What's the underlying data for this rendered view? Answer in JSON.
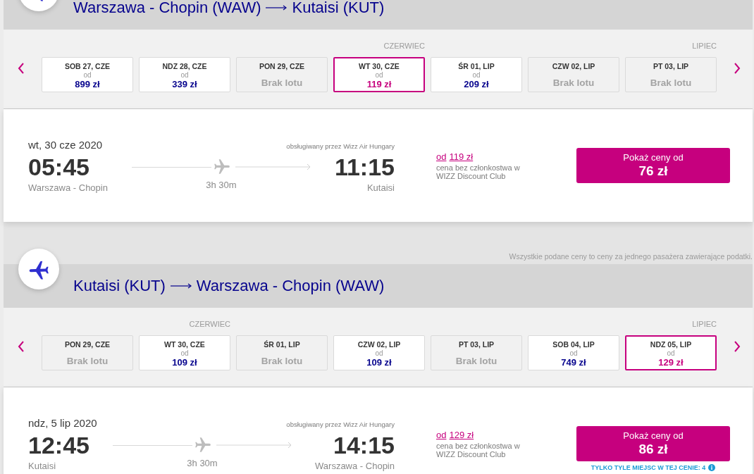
{
  "sections": [
    {
      "route_from": "Warszawa - Chopin (WAW)",
      "route_to": "Kutaisi (KUT)",
      "days": [
        {
          "kind": "fare",
          "label": "SOB 27, CZE",
          "from": "od",
          "price": "899 zł",
          "selected": false
        },
        {
          "kind": "fare",
          "label": "NDZ 28, CZE",
          "from": "od",
          "price": "339 zł",
          "selected": false
        },
        {
          "kind": "unavailable",
          "label": "PON 29, CZE",
          "note": "Brak lotu",
          "selected": false
        },
        {
          "kind": "fare",
          "month": "CZERWIEC",
          "label": "WT 30, CZE",
          "from": "od",
          "price": "119 zł",
          "selected": true
        },
        {
          "kind": "fare",
          "label": "ŚR 01, LIP",
          "from": "od",
          "price": "209 zł",
          "selected": false
        },
        {
          "kind": "unavailable",
          "label": "CZW 02, LIP",
          "note": "Brak lotu",
          "selected": false
        },
        {
          "kind": "unavailable",
          "month": "LIPIEC",
          "label": "PT 03, LIP",
          "note": "Brak lotu",
          "selected": false
        }
      ],
      "flight": {
        "date": "wt, 30 cze 2020",
        "operator": "obsługiwany przez Wizz Air Hungary",
        "departure_time": "05:45",
        "departure_airport": "Warszawa - Chopin",
        "duration": "3h 30m",
        "arrival_time": "11:15",
        "arrival_airport": "Kutaisi",
        "price_from": "od",
        "price": "119 zł",
        "price_note": "cena bez członkostwa w WIZZ Discount Club",
        "button_label": "Pokaż ceny od",
        "button_price": "76 zł"
      }
    },
    {
      "notice": "Wszystkie podane ceny to ceny za jednego pasażera zawierające podatki.",
      "route_from": "Kutaisi (KUT)",
      "route_to": "Warszawa - Chopin (WAW)",
      "days": [
        {
          "kind": "unavailable",
          "label": "PON 29, CZE",
          "note": "Brak lotu",
          "selected": false
        },
        {
          "kind": "fare",
          "month": "CZERWIEC",
          "label": "WT 30, CZE",
          "from": "od",
          "price": "109 zł",
          "selected": false
        },
        {
          "kind": "unavailable",
          "label": "ŚR 01, LIP",
          "note": "Brak lotu",
          "selected": false
        },
        {
          "kind": "fare",
          "label": "CZW 02, LIP",
          "from": "od",
          "price": "109 zł",
          "selected": false
        },
        {
          "kind": "unavailable",
          "label": "PT 03, LIP",
          "note": "Brak lotu",
          "selected": false
        },
        {
          "kind": "fare",
          "label": "SOB 04, LIP",
          "from": "od",
          "price": "749 zł",
          "selected": false
        },
        {
          "kind": "fare",
          "month": "LIPIEC",
          "label": "NDZ 05, LIP",
          "from": "od",
          "price": "129 zł",
          "selected": true
        }
      ],
      "flight": {
        "date": "ndz, 5 lip 2020",
        "operator": "obsługiwany przez Wizz Air Hungary",
        "departure_time": "12:45",
        "departure_airport": "Kutaisi",
        "duration": "3h 30m",
        "arrival_time": "14:15",
        "arrival_airport": "Warszawa - Chopin",
        "price_from": "od",
        "price": "129 zł",
        "price_note": "cena bez członkostwa w WIZZ Discount Club",
        "button_label": "Pokaż ceny od",
        "button_price": "86 zł",
        "seats_note": "TYLKO TYLE MIEJSC W TEJ CENIE: 4"
      }
    }
  ]
}
